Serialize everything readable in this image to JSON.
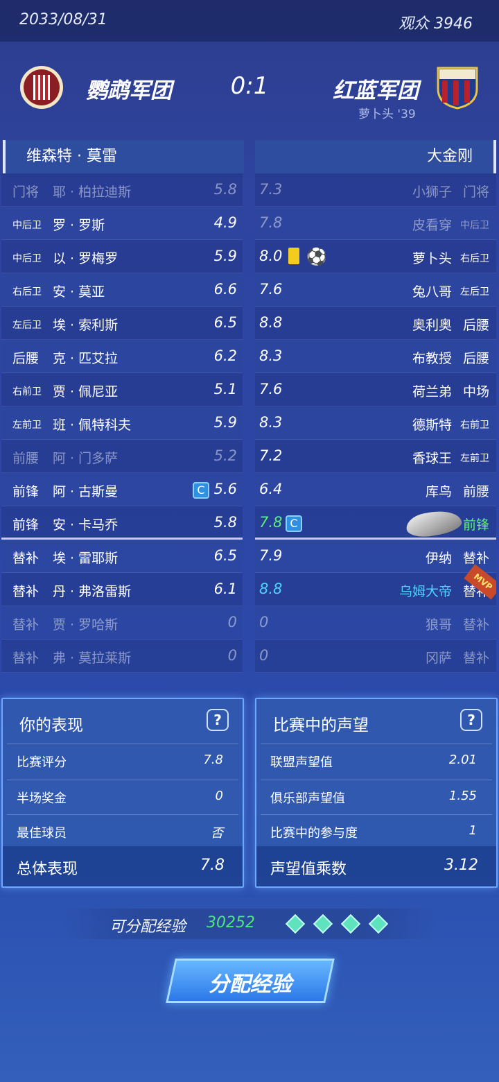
{
  "header": {
    "date": "2033/08/31",
    "audience": "观众 3946"
  },
  "match": {
    "home": "鹦鹉军团",
    "away": "红蓝军团",
    "score": "0:1",
    "scorer": "萝卜头 '39"
  },
  "left_team": {
    "captain_name": "维森特 · 莫雷",
    "players": [
      {
        "pos": "门将",
        "name": "耶 · 柏拉迪斯",
        "rating": "5.8",
        "dim": true
      },
      {
        "pos": "中后卫",
        "name": "罗 · 罗斯",
        "rating": "4.9"
      },
      {
        "pos": "中后卫",
        "name": "以 · 罗梅罗",
        "rating": "5.9"
      },
      {
        "pos": "右后卫",
        "name": "安 · 莫亚",
        "rating": "6.6"
      },
      {
        "pos": "左后卫",
        "name": "埃 · 索利斯",
        "rating": "6.5"
      },
      {
        "pos": "后腰",
        "name": "克 · 匹艾拉",
        "rating": "6.2"
      },
      {
        "pos": "右前卫",
        "name": "贾 · 佩尼亚",
        "rating": "5.1"
      },
      {
        "pos": "左前卫",
        "name": "班 · 佩特科夫",
        "rating": "5.9"
      },
      {
        "pos": "前腰",
        "name": "阿 · 门多萨",
        "rating": "5.2",
        "dim": true
      },
      {
        "pos": "前锋",
        "name": "阿 · 古斯曼",
        "rating": "5.6",
        "captain": "C"
      },
      {
        "pos": "前锋",
        "name": "安 · 卡马乔",
        "rating": "5.8"
      },
      {
        "pos": "替补",
        "name": "埃 · 雷耶斯",
        "rating": "6.5"
      },
      {
        "pos": "替补",
        "name": "丹 · 弗洛雷斯",
        "rating": "6.1"
      },
      {
        "pos": "替补",
        "name": "贾 · 罗哈斯",
        "rating": "0",
        "dim": true
      },
      {
        "pos": "替补",
        "name": "弗 · 莫拉莱斯",
        "rating": "0",
        "dim": true
      }
    ]
  },
  "right_team": {
    "captain_name": "大金刚",
    "players": [
      {
        "pos": "门将",
        "name": "小狮子",
        "rating": "7.3",
        "dim": true
      },
      {
        "pos": "中后卫",
        "name": "皮看穿",
        "rating": "7.8",
        "dim": true
      },
      {
        "pos": "右后卫",
        "name": "萝卜头",
        "rating": "8.0"
      },
      {
        "pos": "左后卫",
        "name": "兔八哥",
        "rating": "7.6"
      },
      {
        "pos": "后腰",
        "name": "奥利奥",
        "rating": "8.8"
      },
      {
        "pos": "后腰",
        "name": "布教授",
        "rating": "8.3"
      },
      {
        "pos": "中场",
        "name": "荷兰弟",
        "rating": "7.6"
      },
      {
        "pos": "右前卫",
        "name": "德斯特",
        "rating": "8.3"
      },
      {
        "pos": "左前卫",
        "name": "香球王",
        "rating": "7.2"
      },
      {
        "pos": "前腰",
        "name": "库鸟",
        "rating": "6.4"
      },
      {
        "pos": "前锋",
        "name": "",
        "rating": "7.8",
        "captain": "C"
      },
      {
        "pos": "替补",
        "name": "伊纳",
        "rating": "7.9"
      },
      {
        "pos": "替补",
        "name": "乌姆大帝",
        "rating": "8.8",
        "mvp": "MVP"
      },
      {
        "pos": "替补",
        "name": "狼哥",
        "rating": "0",
        "dim": true
      },
      {
        "pos": "替补",
        "name": "冈萨",
        "rating": "0",
        "dim": true
      }
    ]
  },
  "perf": {
    "title": "你的表现",
    "rows": [
      {
        "k": "比赛评分",
        "v": "7.8"
      },
      {
        "k": "半场奖金",
        "v": "0"
      },
      {
        "k": "最佳球员",
        "v": "否"
      }
    ],
    "total_k": "总体表现",
    "total_v": "7.8"
  },
  "rep": {
    "title": "比赛中的声望",
    "rows": [
      {
        "k": "联盟声望值",
        "v": "2.01"
      },
      {
        "k": "俱乐部声望值",
        "v": "1.55"
      },
      {
        "k": "比赛中的参与度",
        "v": "1"
      }
    ],
    "total_k": "声望值乘数",
    "total_v": "3.12"
  },
  "exp": {
    "label": "可分配经验",
    "value": "30252",
    "button": "分配经验"
  },
  "colors": {
    "accent_green": "#5cf07a",
    "accent_cyan": "#4fd2ff"
  }
}
